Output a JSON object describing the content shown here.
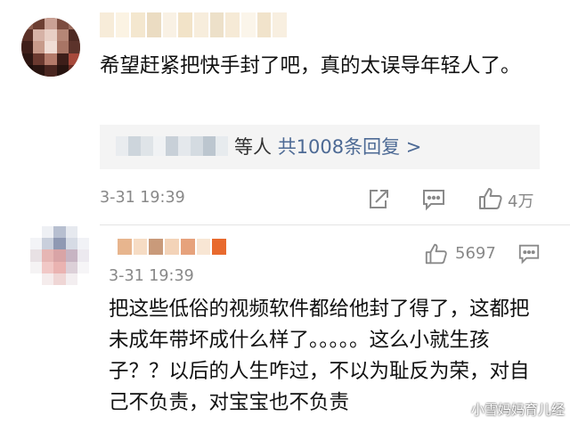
{
  "comments": [
    {
      "text": "希望赶紧把快手封了吧，真的太误导年轻人了。",
      "reply_summary": {
        "prefix_blurred": "",
        "suffix": "等人",
        "count_label": "共1008条回复 >"
      },
      "time": "3-31 19:39",
      "likes": "4万",
      "actions": [
        "share-icon",
        "comment-icon",
        "like-icon"
      ]
    },
    {
      "text": "把这些低俗的视频软件都给他封了得了，这都把未成年带坏成什么样了。。。。。这么小就生孩子？？以后的人生咋过，不以为耻反为荣，对自己不负责，对宝宝也不负责",
      "time": "3-31 19:39",
      "likes": "5697",
      "actions": [
        "like-icon",
        "comment-icon"
      ]
    }
  ],
  "watermark": "小雪妈妈育儿经",
  "colors": {
    "link": "#4d6a95",
    "reply_bg": "#f4f4f4",
    "meta": "#888888"
  }
}
